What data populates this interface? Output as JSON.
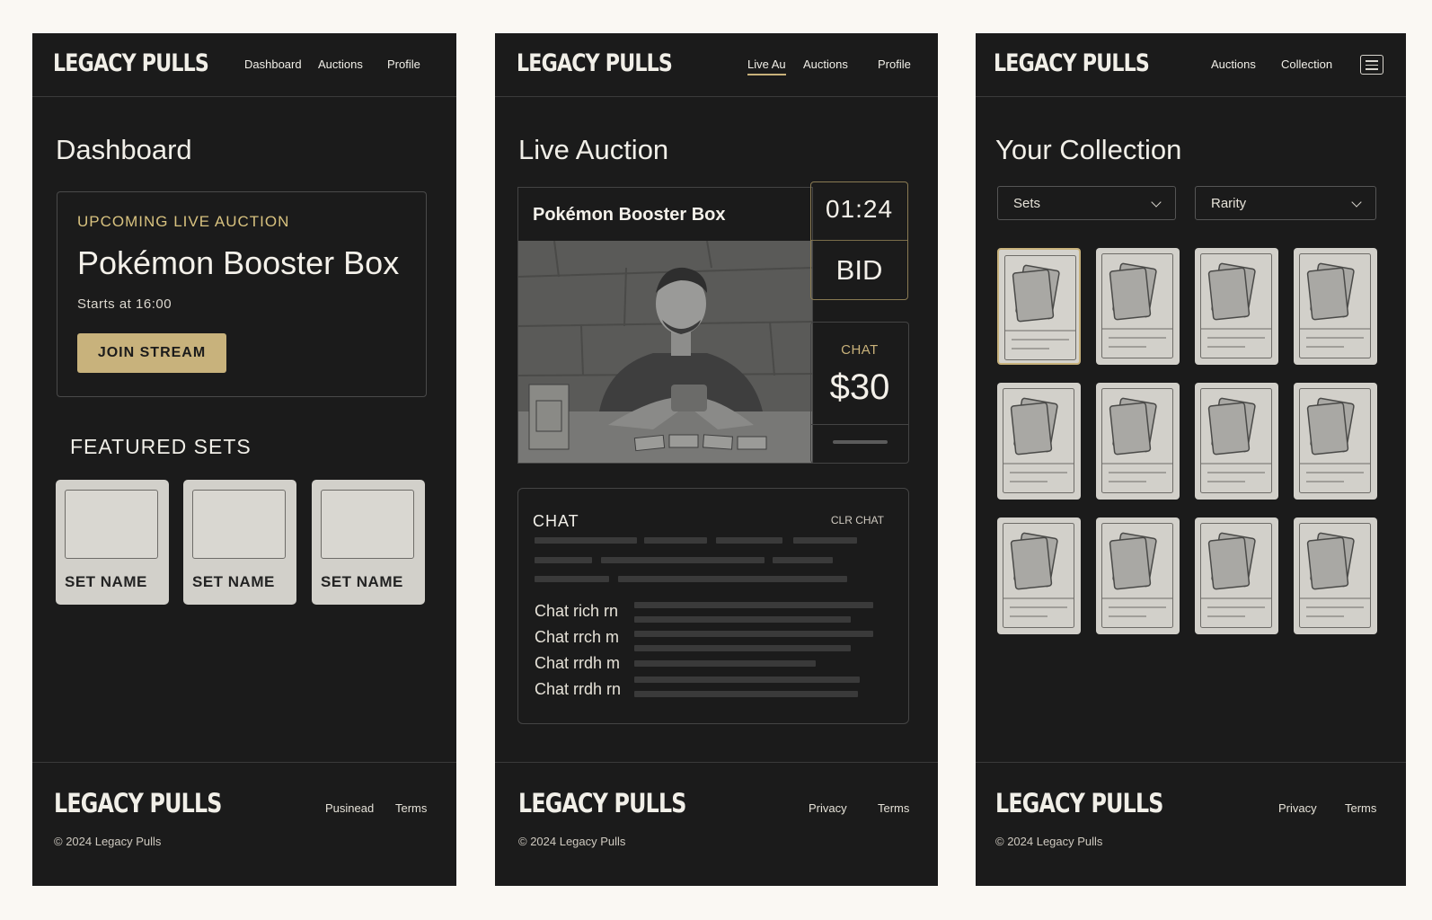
{
  "dashboard": {
    "logo": "LEGACY PULLS",
    "nav": [
      "Dashboard",
      "Auctions",
      "Profile"
    ],
    "title": "Dashboard",
    "upcoming": {
      "tag": "UPCOMING LIVE AUCTION",
      "title": "Pokémon Booster Box",
      "start": "Starts at 16:00",
      "button": "JOIN STREAM"
    },
    "featured_title": "FEATURED SETS",
    "sets": [
      "SET NAME",
      "SET NAME",
      "SET NAME"
    ],
    "footer": {
      "logo": "LEGACY PULLS",
      "links": [
        "Pusinead",
        "Terms"
      ],
      "copyright": "© 2024 Legacy Pulls"
    }
  },
  "live": {
    "logo": "LEGACY PULLS",
    "nav": [
      "Live Au",
      "Auctions",
      "Profile"
    ],
    "active_nav": "Live Au",
    "title": "Live Auction",
    "product": "Pokémon Booster Box",
    "timer": "01:24",
    "bid_label": "BID",
    "side_label": "CHAT",
    "price": "$30",
    "chat": {
      "title": "CHAT",
      "clear": "CLR CHAT",
      "messages": [
        "Chat rich rn",
        "Chat rrch m",
        "Chat rrdh m",
        "Chat rrdh rn"
      ]
    },
    "footer": {
      "logo": "LEGACY PULLS",
      "links": [
        "Privacy",
        "Terms"
      ],
      "copyright": "© 2024 Legacy Pulls"
    }
  },
  "collection": {
    "logo": "LEGACY PULLS",
    "nav": [
      "Auctions",
      "Collection"
    ],
    "menu_icon": "menu-icon",
    "title": "Your Collection",
    "filters": [
      {
        "label": "Sets",
        "icon": "chevron-down-icon"
      },
      {
        "label": "Rarity",
        "icon": "chevron-down-icon"
      }
    ],
    "cards": {
      "rows": 3,
      "cols": 4,
      "selected_index": 0
    },
    "footer": {
      "logo": "LEGACY PULLS",
      "links": [
        "Privacy",
        "Terms"
      ],
      "copyright": "© 2024 Legacy Pulls"
    }
  },
  "colors": {
    "panel": "#1b1b1b",
    "accent": "#c8b27c",
    "page": "#faf8f3",
    "card": "#d2d0ca"
  }
}
